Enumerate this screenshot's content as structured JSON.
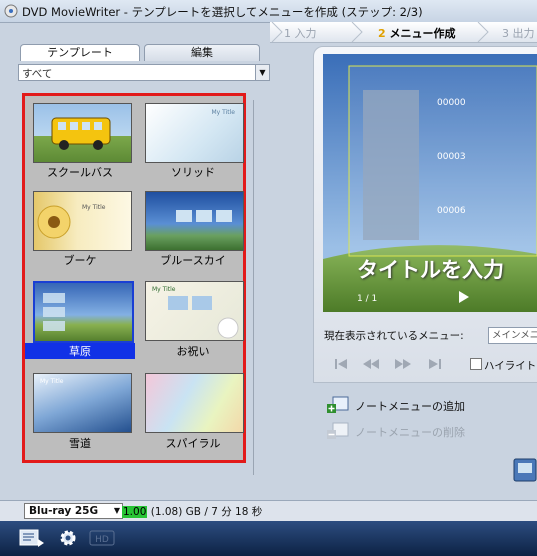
{
  "window": {
    "title": "DVD MovieWriter - テンプレートを選択してメニューを作成 (ステップ: 2/3)",
    "app_icon": "dvd-app-icon"
  },
  "steps": [
    {
      "num": "1",
      "label": "入力",
      "state": "done"
    },
    {
      "num": "2",
      "label": "メニュー作成",
      "state": "active"
    },
    {
      "num": "3",
      "label": "出力",
      "state": "pending"
    }
  ],
  "left_panel": {
    "tabs": [
      {
        "label": "テンプレート",
        "active": true
      },
      {
        "label": "編集",
        "active": false
      }
    ],
    "filter": {
      "value": "すべて",
      "icon": "dropdown-arrow-icon"
    },
    "templates": [
      {
        "label": "スクールバス",
        "selected": false
      },
      {
        "label": "ソリッド",
        "selected": false
      },
      {
        "label": "ブーケ",
        "selected": false
      },
      {
        "label": "ブルースカイ",
        "selected": false
      },
      {
        "label": "草原",
        "selected": true
      },
      {
        "label": "お祝い",
        "selected": false
      },
      {
        "label": "雪道",
        "selected": false
      },
      {
        "label": "スパイラル",
        "selected": false
      }
    ],
    "thumb_text": {
      "solid": "My Title",
      "bouquet": "My Title",
      "celebration": "My Title",
      "snow": "My Title"
    },
    "highlight_color": "#e21a1a",
    "selection_color": "#1131e6"
  },
  "preview": {
    "title_text": "タイトルを入力",
    "chapters": [
      "00000",
      "00003",
      "00006"
    ],
    "page": "1 / 1",
    "play_icon": "play-icon"
  },
  "menu_controls": {
    "current_menu_label": "現在表示されているメニュー:",
    "current_menu_value": "メインメニュー",
    "nav_icons": [
      "first-icon",
      "prev-icon",
      "next-icon",
      "last-icon"
    ],
    "highlight_label": "ハイライトした"
  },
  "actions": [
    {
      "label": "ノートメニューの追加",
      "icon": "add-menu-icon",
      "enabled": true
    },
    {
      "label": "ノートメニューの削除",
      "icon": "delete-menu-icon",
      "enabled": false
    }
  ],
  "status": {
    "disc_type": "Blu-ray 25G",
    "used": "1.00",
    "total": "(1.08) GB",
    "time": "/ 7 分 18 秒"
  },
  "toolbar": {
    "icons": [
      "project-settings-icon",
      "preferences-gear-icon",
      "hd-disabled-icon"
    ]
  }
}
